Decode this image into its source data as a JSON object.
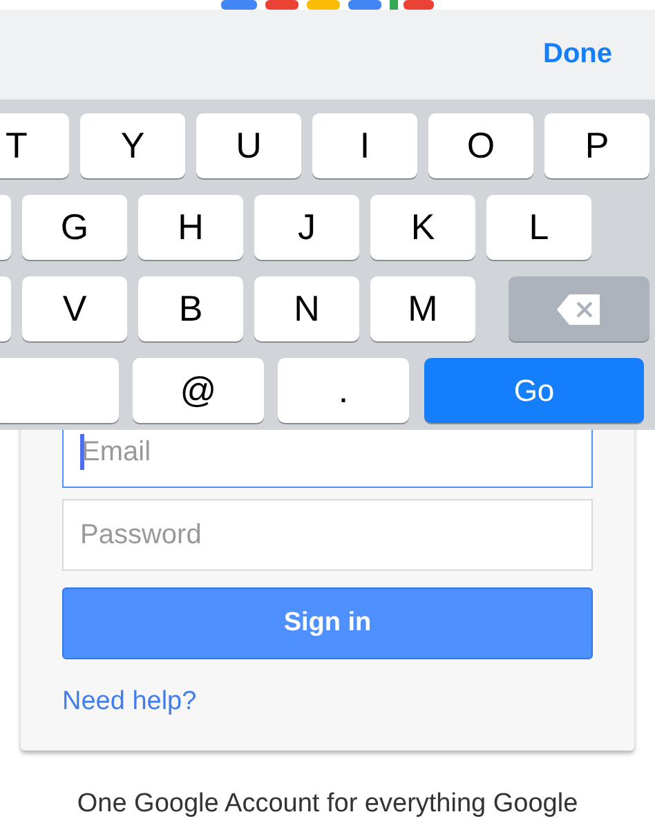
{
  "form": {
    "email": {
      "placeholder": "Email",
      "focused": true
    },
    "password": {
      "placeholder": "Password",
      "focused": false
    },
    "submit": "Sign in",
    "help_link": "Need help?"
  },
  "footer": "One Google Account for everything Google",
  "keyboard": {
    "done": "Done",
    "rows": [
      {
        "keys": [
          {
            "label": "T",
            "kind": "letter"
          },
          {
            "label": "Y",
            "kind": "letter"
          },
          {
            "label": "U",
            "kind": "letter"
          },
          {
            "label": "I",
            "kind": "letter"
          },
          {
            "label": "O",
            "kind": "letter"
          },
          {
            "label": "P",
            "kind": "letter"
          }
        ]
      },
      {
        "keys": [
          {
            "kind": "blank"
          },
          {
            "label": "G",
            "kind": "letter"
          },
          {
            "label": "H",
            "kind": "letter"
          },
          {
            "label": "J",
            "kind": "letter"
          },
          {
            "label": "K",
            "kind": "letter"
          },
          {
            "label": "L",
            "kind": "letter"
          }
        ]
      },
      {
        "keys": [
          {
            "kind": "blank"
          },
          {
            "label": "V",
            "kind": "letter"
          },
          {
            "label": "B",
            "kind": "letter"
          },
          {
            "label": "N",
            "kind": "letter"
          },
          {
            "label": "M",
            "kind": "letter"
          },
          {
            "kind": "delete"
          }
        ]
      },
      {
        "keys": [
          {
            "kind": "space"
          },
          {
            "label": "@",
            "kind": "symbol"
          },
          {
            "label": ".",
            "kind": "symbol"
          },
          {
            "label": "Go",
            "kind": "go"
          }
        ]
      }
    ]
  }
}
